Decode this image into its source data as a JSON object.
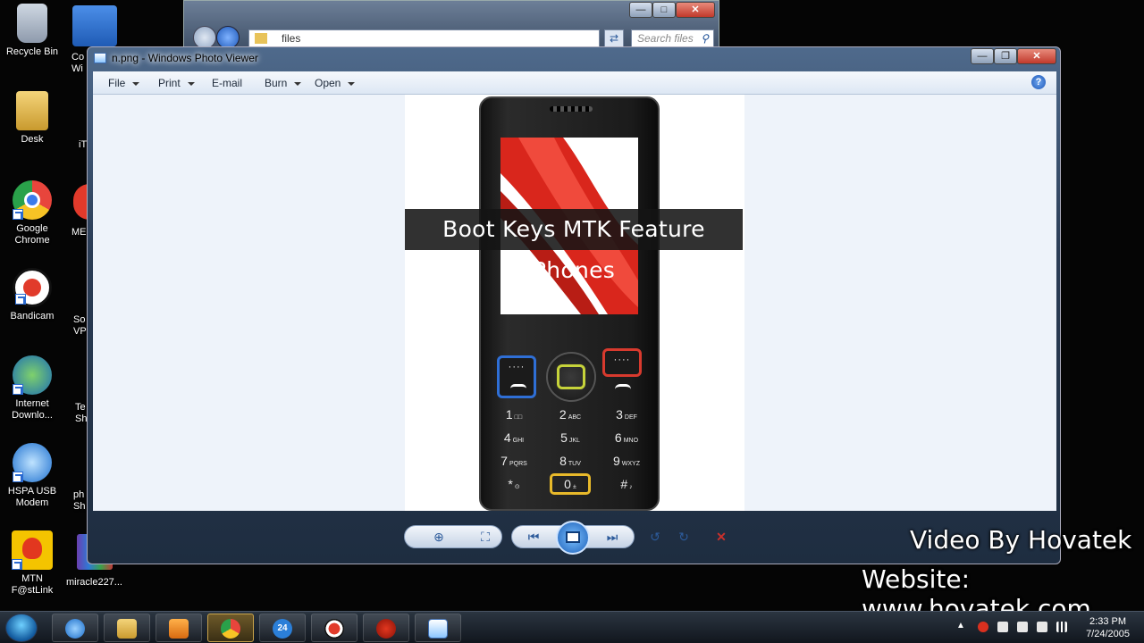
{
  "desktop": {
    "icons": [
      {
        "label": "Recycle Bin"
      },
      {
        "label": "Desk"
      },
      {
        "label": "Google Chrome"
      },
      {
        "label": "Bandicam"
      },
      {
        "label": "Internet Downlo..."
      },
      {
        "label": "HSPA USB Modem"
      },
      {
        "label": "MTN F@stLink"
      }
    ],
    "partial_icons": [
      {
        "label": "Co Wi"
      },
      {
        "label": "iT"
      },
      {
        "label": "ME"
      },
      {
        "label": "So VPI"
      },
      {
        "label": "Te Sh"
      },
      {
        "label": "ph Sh"
      },
      {
        "label": "miracle227..."
      }
    ]
  },
  "explorer": {
    "address": "files",
    "search_placeholder": "Search files"
  },
  "viewer": {
    "title": "n.png - Windows Photo Viewer",
    "menu": [
      {
        "label": "File",
        "has_dropdown": true
      },
      {
        "label": "Print",
        "has_dropdown": true
      },
      {
        "label": "E-mail",
        "has_dropdown": false
      },
      {
        "label": "Burn",
        "has_dropdown": true
      },
      {
        "label": "Open",
        "has_dropdown": true
      }
    ],
    "help_glyph": "?"
  },
  "phone": {
    "keys": [
      {
        "main": "1",
        "sub": "□□"
      },
      {
        "main": "2",
        "sub": "ABC"
      },
      {
        "main": "3",
        "sub": "DEF"
      },
      {
        "main": "4",
        "sub": "GHI"
      },
      {
        "main": "5",
        "sub": "JKL"
      },
      {
        "main": "6",
        "sub": "MNO"
      },
      {
        "main": "7",
        "sub": "PQRS"
      },
      {
        "main": "8",
        "sub": "TUV"
      },
      {
        "main": "9",
        "sub": "WXYZ"
      },
      {
        "main": "*",
        "sub": "⊙"
      },
      {
        "main": "0",
        "sub": "±"
      },
      {
        "main": "#",
        "sub": "♪"
      }
    ],
    "softkey_dots": "····"
  },
  "overlay": {
    "title": "Boot Keys MTK Feature Phones"
  },
  "watermark": {
    "line1": "Video By Hovatek",
    "line2": "Website: www.hovatek.com"
  },
  "taskbar": {
    "clock_time": "2:33 PM",
    "clock_date": "7/24/2005",
    "badge_24": "24"
  },
  "colors": {
    "softkey_left": "#2f6fd6",
    "softkey_right": "#d83a2e",
    "dpad_ring": "#c6d33a",
    "zero_key_ring": "#e8b92a"
  }
}
